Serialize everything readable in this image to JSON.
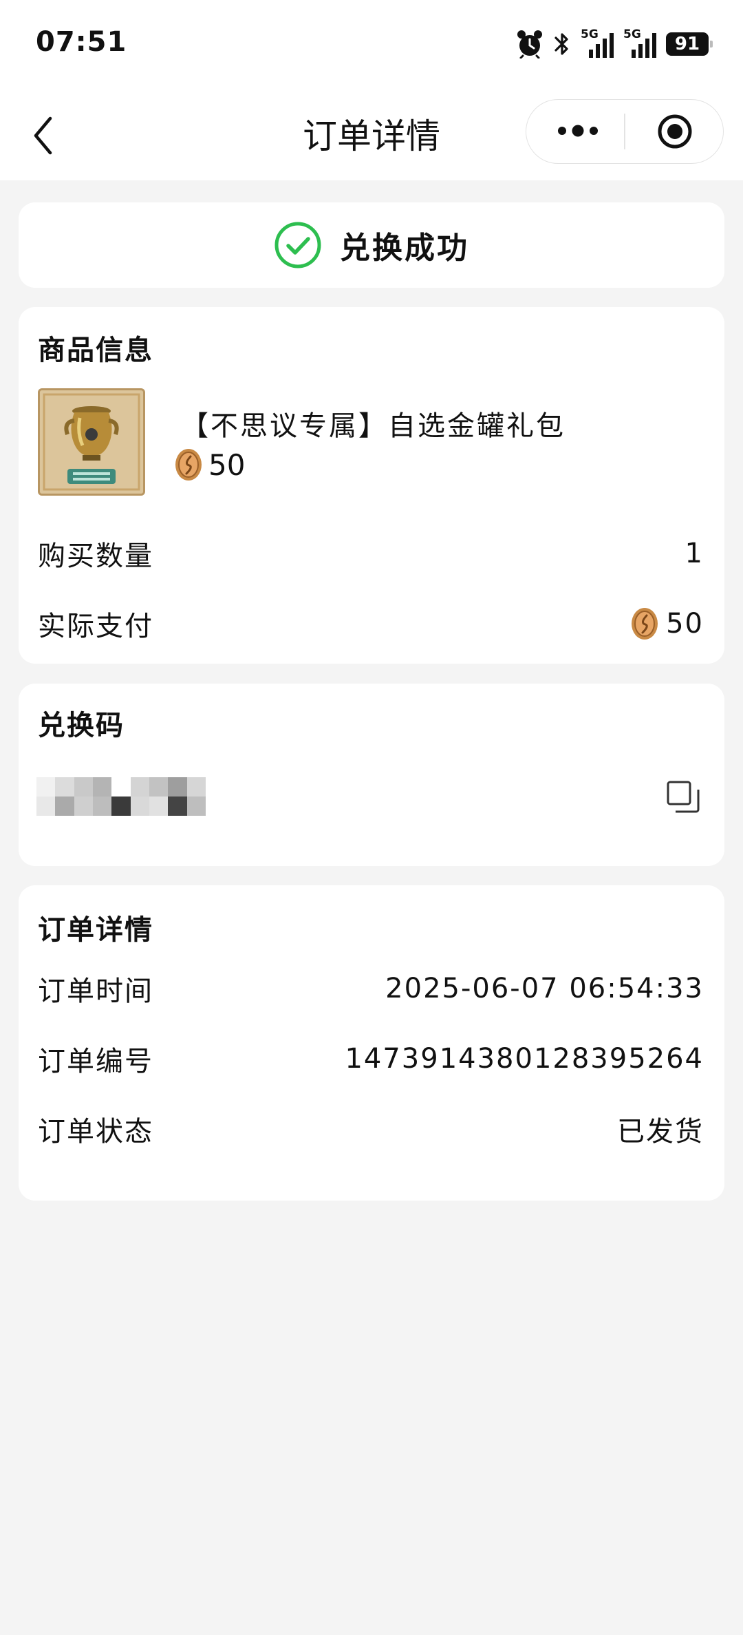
{
  "status_bar": {
    "time": "07:51",
    "signal_1_tag": "5G",
    "signal_2_tag": "5G",
    "battery": "91"
  },
  "nav": {
    "title": "订单详情"
  },
  "banner": {
    "text": "兑换成功",
    "color": "#2dbe4f"
  },
  "goods": {
    "section_title": "商品信息",
    "name": "【不思议专属】自选金罐礼包",
    "price": "50",
    "quantity_label": "购买数量",
    "quantity_value": "1",
    "paid_label": "实际支付",
    "paid_value": "50"
  },
  "redeem": {
    "section_title": "兑换码",
    "masked": true
  },
  "order": {
    "section_title": "订单详情",
    "time_label": "订单时间",
    "time_value": "2025-06-07 06:54:33",
    "number_label": "订单编号",
    "number_value": "1473914380128395264",
    "status_label": "订单状态",
    "status_value": "已发货"
  }
}
